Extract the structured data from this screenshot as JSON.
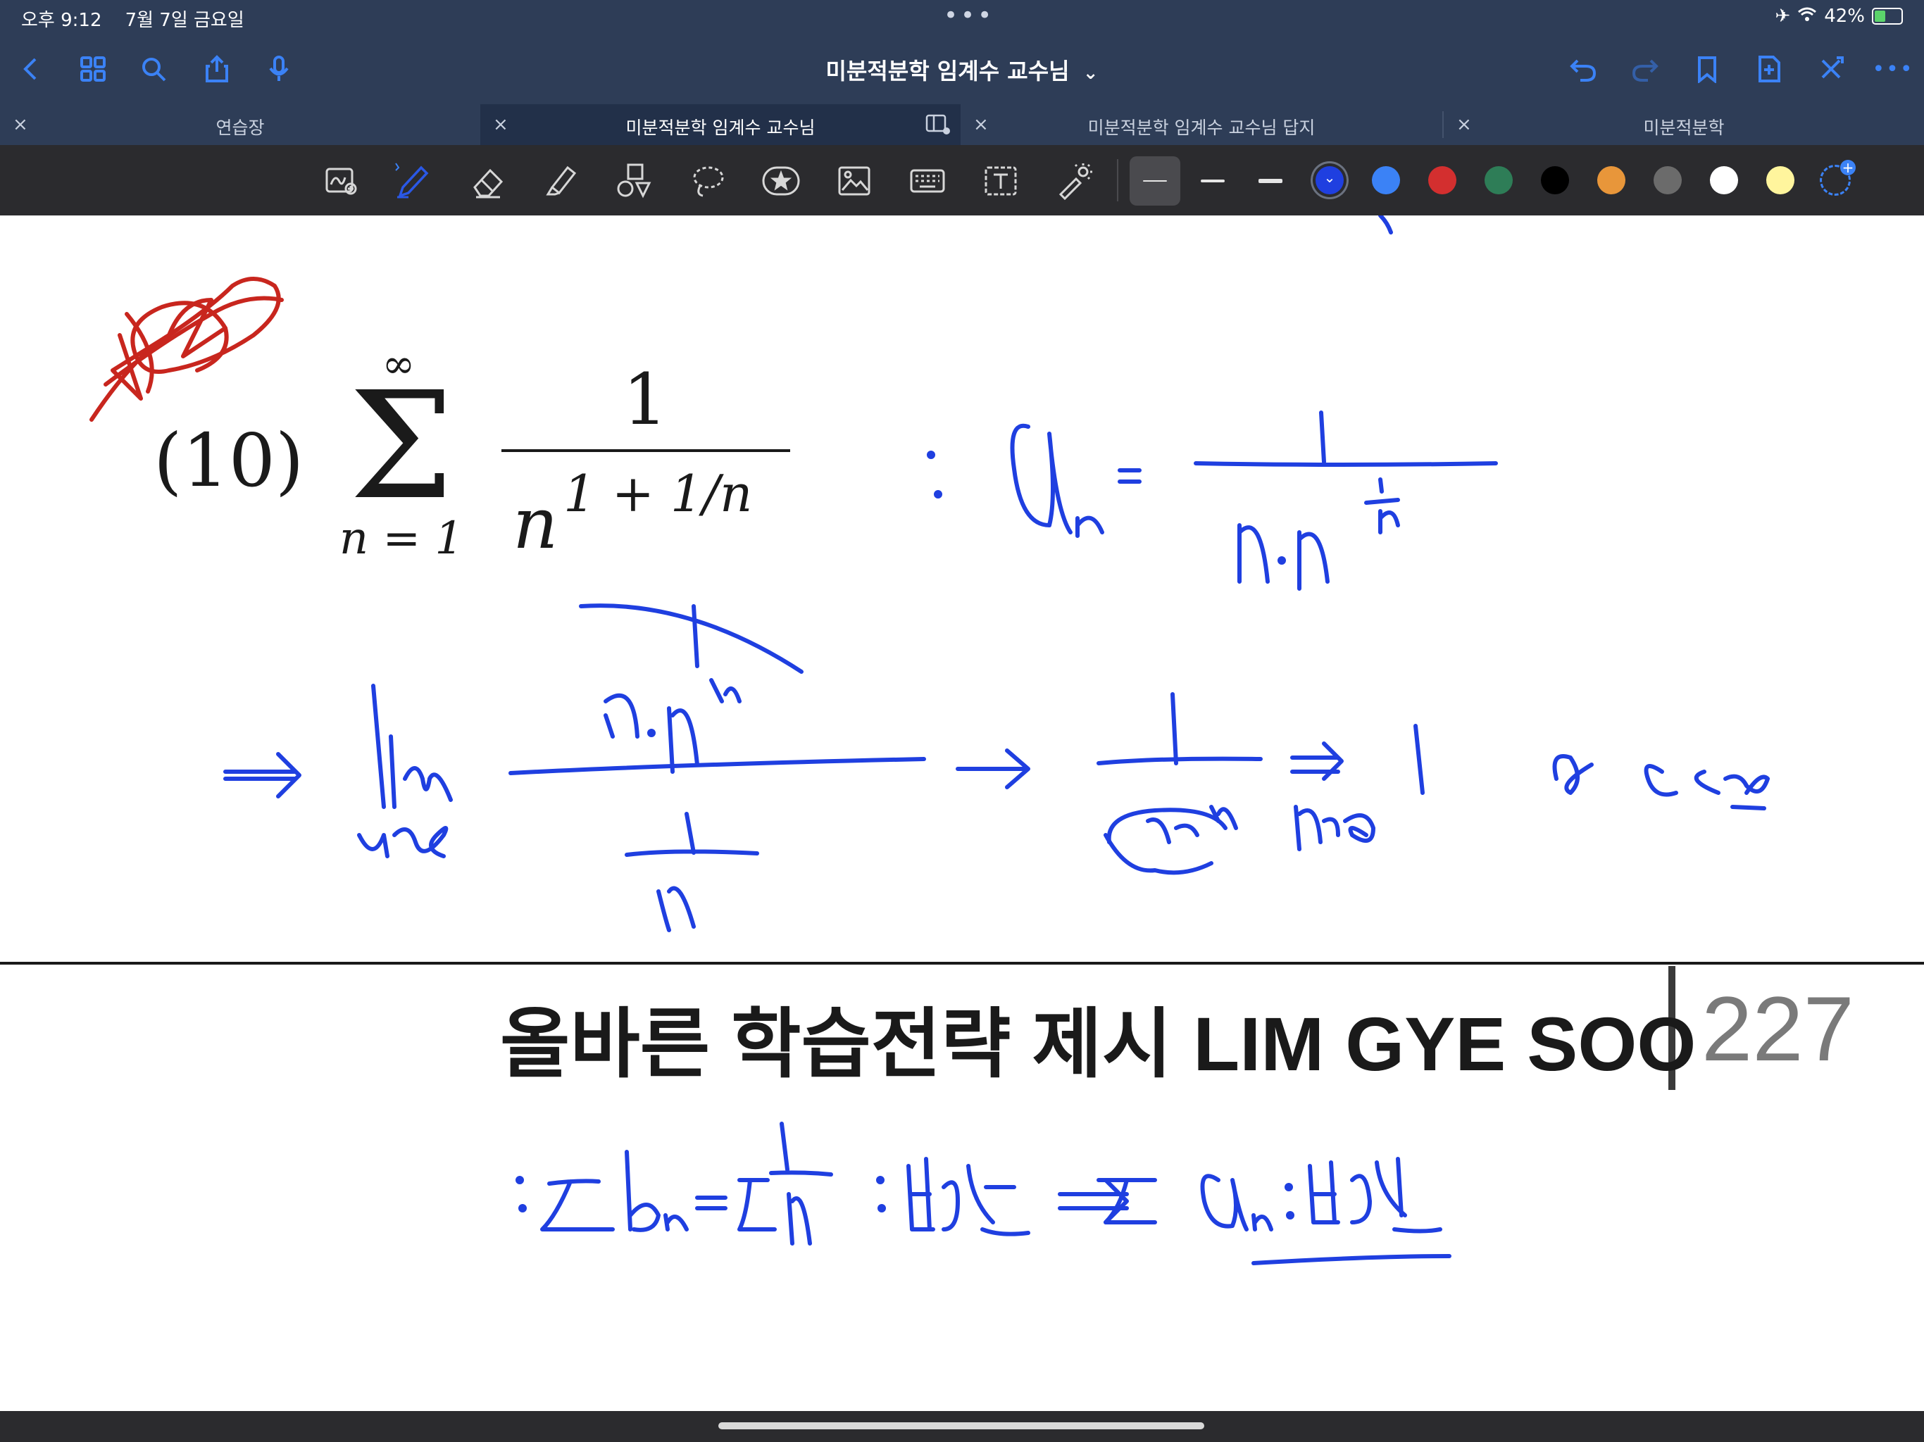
{
  "status_bar": {
    "time": "오후 9:12",
    "date": "7월 7일 금요일",
    "battery": "42%",
    "battery_level": 0.42
  },
  "nav": {
    "title": "미분적분학 임계수 교수님",
    "title_chevron": "⌄"
  },
  "tabs": [
    {
      "label": "연습장",
      "active": false
    },
    {
      "label": "미분적분학 임계수 교수님",
      "active": true
    },
    {
      "label": "미분적분학 임계수 교수님 답지",
      "active": false
    },
    {
      "label": "미분적분학",
      "active": false
    }
  ],
  "tab_close_glyph": "×",
  "colors": {
    "chrome": "#2e3d57",
    "toolbar": "#2b2b2e",
    "accent": "#3b82f6",
    "ink_blue": "#1f3fe0",
    "ink_red": "#c8261e"
  },
  "palette": [
    "#1f3fe0",
    "#3b82f6",
    "#d32f2f",
    "#2e7d57",
    "#000000",
    "#e8963a",
    "#6b6b6b",
    "#ffffff",
    "#fff59d"
  ],
  "selected_color_index": 0,
  "page": {
    "problem_number": "(10)",
    "sum_upper": "∞",
    "sum_symbol": "Σ",
    "sum_lower": "n = 1",
    "fraction_numerator": "1",
    "fraction_base": "n",
    "fraction_exponent": "1 + 1/n",
    "footer_text": "올바른 학습전략 제시 LIM GYE SOO",
    "page_number": "227"
  }
}
